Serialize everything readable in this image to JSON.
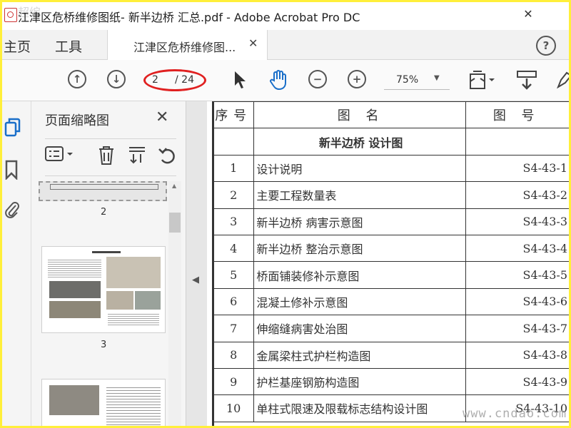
{
  "window": {
    "title": "江津区危桥维修图纸- 新半边桥 汇总.pdf - Adobe Acrobat Pro DC",
    "minimize": "—",
    "maximize": "☐",
    "close": "✕"
  },
  "tabs": {
    "home": "主页",
    "tools": "工具",
    "document": "江津区危桥维修图...",
    "document_close": "✕",
    "help": "?"
  },
  "toolbar": {
    "current_page": "2",
    "total_pages": "/ 24",
    "zoom": "75%"
  },
  "thumbnails": {
    "title": "页面缩略图",
    "close": "✕",
    "pages": [
      {
        "label": "2"
      },
      {
        "label": "3"
      }
    ]
  },
  "document": {
    "header": {
      "no": "序号",
      "name": "图 名",
      "code": "图 号"
    },
    "section": "新半边桥 设计图",
    "rows": [
      {
        "no": "1",
        "name": "设计说明",
        "code": "S4-43-1"
      },
      {
        "no": "2",
        "name": "主要工程数量表",
        "code": "S4-43-2"
      },
      {
        "no": "3",
        "name": "新半边桥 病害示意图",
        "code": "S4-43-3"
      },
      {
        "no": "4",
        "name": "新半边桥 整治示意图",
        "code": "S4-43-4"
      },
      {
        "no": "5",
        "name": "桥面铺装修补示意图",
        "code": "S4-43-5"
      },
      {
        "no": "6",
        "name": "混凝土修补示意图",
        "code": "S4-43-6"
      },
      {
        "no": "7",
        "name": "伸缩缝病害处治图",
        "code": "S4-43-7"
      },
      {
        "no": "8",
        "name": "金属梁柱式护栏构造图",
        "code": "S4-43-8"
      },
      {
        "no": "9",
        "name": "护栏基座钢筋构造图",
        "code": "S4-43-9"
      },
      {
        "no": "10",
        "name": "单柱式限速及限载标志结构设计图",
        "code": "S4-43-10"
      }
    ]
  },
  "watermark": "www.cndao.com",
  "colors": {
    "highlight_oval": "#e02020",
    "frame": "#ffef3a",
    "hand_tool": "#1a6fc9"
  }
}
